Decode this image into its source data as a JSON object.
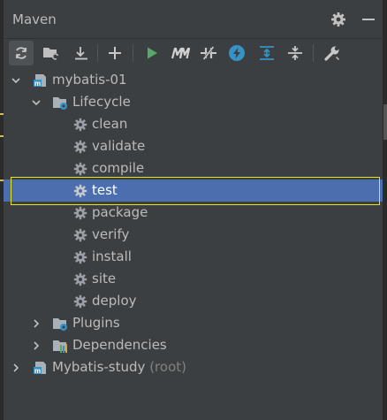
{
  "panel": {
    "title": "Maven"
  },
  "header_icons": [
    "gear-icon",
    "minimize-icon"
  ],
  "toolbar": {
    "buttons": [
      {
        "name": "reload-all-projects-button",
        "icon": "reload-icon"
      },
      {
        "name": "generate-sources-button",
        "icon": "folder-reload-icon"
      },
      {
        "name": "download-sources-button",
        "icon": "download-icon"
      },
      {
        "name": "add-maven-project-button",
        "icon": "plus-icon"
      },
      {
        "name": "run-maven-build-button",
        "icon": "play-icon"
      },
      {
        "name": "execute-maven-goal-button",
        "icon": "m-icon"
      },
      {
        "name": "toggle-offline-mode-button",
        "icon": "offline-icon"
      },
      {
        "name": "toggle-skip-tests-button",
        "icon": "lightning-icon"
      },
      {
        "name": "show-dependencies-button",
        "icon": "expand-all-icon"
      },
      {
        "name": "collapse-all-button",
        "icon": "collapse-all-icon"
      },
      {
        "name": "maven-settings-button",
        "icon": "wrench-icon"
      }
    ]
  },
  "tree": {
    "root1": {
      "label": "mybatis-01"
    },
    "lifecycle": {
      "label": "Lifecycle"
    },
    "goals": [
      "clean",
      "validate",
      "compile",
      "test",
      "package",
      "verify",
      "install",
      "site",
      "deploy"
    ],
    "selected_goal": "test",
    "plugins": {
      "label": "Plugins"
    },
    "dependencies": {
      "label": "Dependencies"
    },
    "root2": {
      "label": "Mybatis-study",
      "suffix": "(root)"
    }
  },
  "colors": {
    "background": "#3c3f41",
    "selection": "#4b6eaf",
    "highlight_outline": "#e6e619",
    "run_green": "#59a869",
    "skip_tests_blue": "#3592c4"
  }
}
